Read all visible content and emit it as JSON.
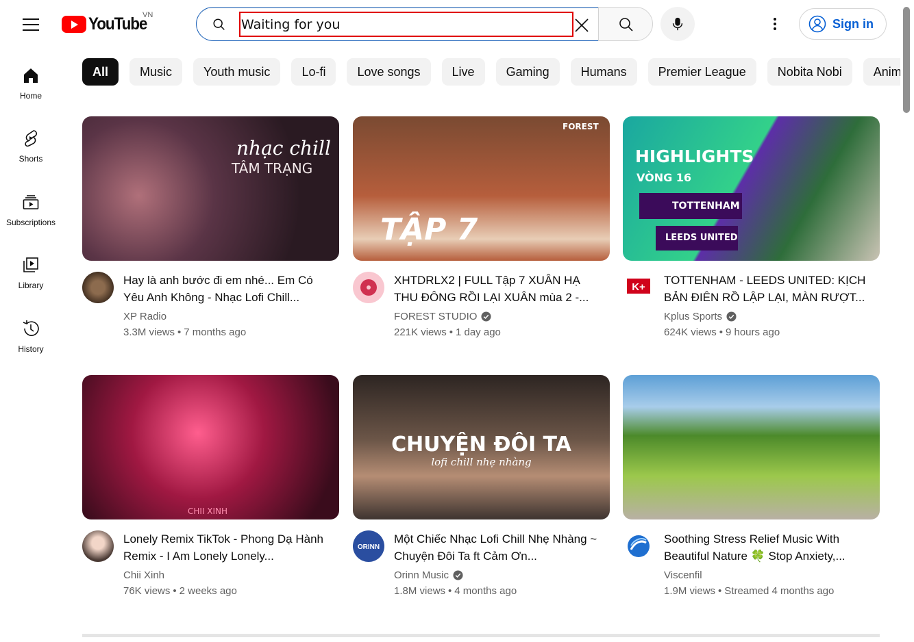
{
  "header": {
    "logo_text": "YouTube",
    "country_code": "VN",
    "search_value": "Waiting for you",
    "signin_label": "Sign in"
  },
  "sidebar": {
    "items": [
      {
        "label": "Home"
      },
      {
        "label": "Shorts"
      },
      {
        "label": "Subscriptions"
      },
      {
        "label": "Library"
      },
      {
        "label": "History"
      }
    ]
  },
  "chips": [
    "All",
    "Music",
    "Youth music",
    "Lo-fi",
    "Love songs",
    "Live",
    "Gaming",
    "Humans",
    "Premier League",
    "Nobita Nobi",
    "Anima"
  ],
  "videos": [
    {
      "title": "Hay là anh bước đi em nhé... Em Có Yêu Anh Không - Nhạc Lofi Chill...",
      "channel": "XP Radio",
      "verified": false,
      "views": "3.3M views",
      "age": "7 months ago",
      "thumb_text": [
        "nhạc chill",
        "TÂM TRẠNG"
      ],
      "thumb_colors": [
        "#2a1a22",
        "#5a3446",
        "#b0707a"
      ]
    },
    {
      "title": "XHTDRLX2 | FULL Tập 7 XUÂN HẠ THU ĐÔNG RỒI LẠI XUÂN mùa 2 -...",
      "channel": "FOREST STUDIO",
      "verified": true,
      "views": "221K views",
      "age": "1 day ago",
      "thumb_text": [
        "TẬP 7",
        "FOREST"
      ],
      "thumb_colors": [
        "#7a4a32",
        "#b65e3c",
        "#e8cdb6"
      ]
    },
    {
      "title": "TOTTENHAM - LEEDS UNITED: KỊCH BẢN ĐIÊN RỒ LẬP LẠI, MÀN RƯỢT...",
      "channel": "Kplus Sports",
      "verified": true,
      "views": "624K views",
      "age": "9 hours ago",
      "thumb_text": [
        "HIGHLIGHTS",
        "VÒNG 16",
        "TOTTENHAM",
        "LEEDS UNITED"
      ],
      "thumb_colors": [
        "#1aa7a0",
        "#33d18a",
        "#5d2ea8"
      ]
    },
    {
      "title": "Lonely Remix TikTok - Phong Dạ Hành Remix - I Am Lonely Lonely...",
      "channel": "Chii Xinh",
      "verified": false,
      "views": "76K views",
      "age": "2 weeks ago",
      "thumb_text": [
        "CHII XINH"
      ],
      "thumb_colors": [
        "#3a0c1c",
        "#a01842",
        "#ff5e8e"
      ]
    },
    {
      "title": "Một Chiếc Nhạc Lofi Chill Nhẹ Nhàng ~ Chuyện Đôi Ta ft Cảm Ơn...",
      "channel": "Orinn Music",
      "verified": true,
      "views": "1.8M views",
      "age": "4 months ago",
      "thumb_text": [
        "CHUYỆN ĐÔI TA",
        "lofi chill nhẹ nhàng"
      ],
      "thumb_colors": [
        "#2d2522",
        "#6c5648",
        "#b58d74"
      ]
    },
    {
      "title": "Soothing Stress Relief Music With Beautiful Nature 🍀 Stop Anxiety,...",
      "channel": "Viscenfil",
      "verified": false,
      "views": "1.9M views",
      "age": "Streamed 4 months ago",
      "thumb_text": [],
      "thumb_colors": [
        "#5d9fd6",
        "#4c8a2a",
        "#9cc84c"
      ]
    }
  ]
}
